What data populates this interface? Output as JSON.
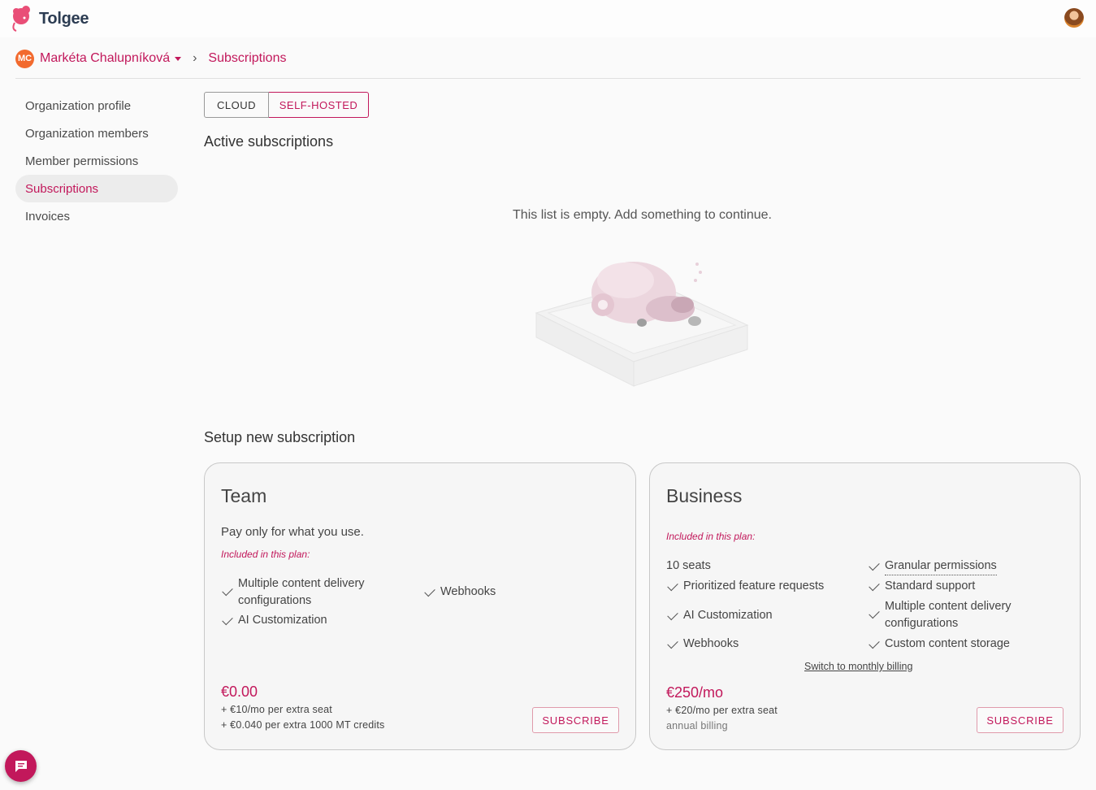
{
  "app": {
    "name": "Tolgee"
  },
  "breadcrumb": {
    "org_initials": "MC",
    "org_name": "Markéta Chalupníková",
    "separator": "›",
    "current": "Subscriptions"
  },
  "sidebar": {
    "items": [
      {
        "label": "Organization profile",
        "active": false
      },
      {
        "label": "Organization members",
        "active": false
      },
      {
        "label": "Member permissions",
        "active": false
      },
      {
        "label": "Subscriptions",
        "active": true
      },
      {
        "label": "Invoices",
        "active": false
      }
    ]
  },
  "tabs": {
    "cloud": "CLOUD",
    "self_hosted": "SELF-HOSTED",
    "selected": "SELF-HOSTED"
  },
  "active_subscriptions": {
    "heading": "Active subscriptions",
    "empty_text": "This list is empty. Add something to continue."
  },
  "setup": {
    "heading": "Setup new subscription"
  },
  "plans": {
    "team": {
      "title": "Team",
      "description": "Pay only for what you use.",
      "included_label": "Included in this plan:",
      "features": [
        "Multiple content delivery configurations",
        "Webhooks",
        "AI Customization"
      ],
      "price": "€0.00",
      "extra_seat": "+ €10/mo per extra seat",
      "extra_credits": "+ €0.040 per extra 1000 MT credits",
      "subscribe_label": "SUBSCRIBE"
    },
    "business": {
      "title": "Business",
      "included_label": "Included in this plan:",
      "seats": "10 seats",
      "features": [
        "Granular permissions",
        "Prioritized feature requests",
        "Standard support",
        "AI Customization",
        "Multiple content delivery configurations",
        "Webhooks",
        "Custom content storage"
      ],
      "switch_billing": "Switch to monthly billing",
      "price": "€250/mo",
      "extra_seat": "+ €20/mo per extra seat",
      "billing_note": "annual billing",
      "subscribe_label": "SUBSCRIBE"
    }
  },
  "colors": {
    "accent": "#c2185b",
    "org_avatar": "#f26a2e",
    "logo": "#e94e77"
  },
  "icons": {
    "logo": "tolgee-logo-icon",
    "chat": "chat-icon",
    "check": "check-icon",
    "caret": "caret-down-icon"
  }
}
